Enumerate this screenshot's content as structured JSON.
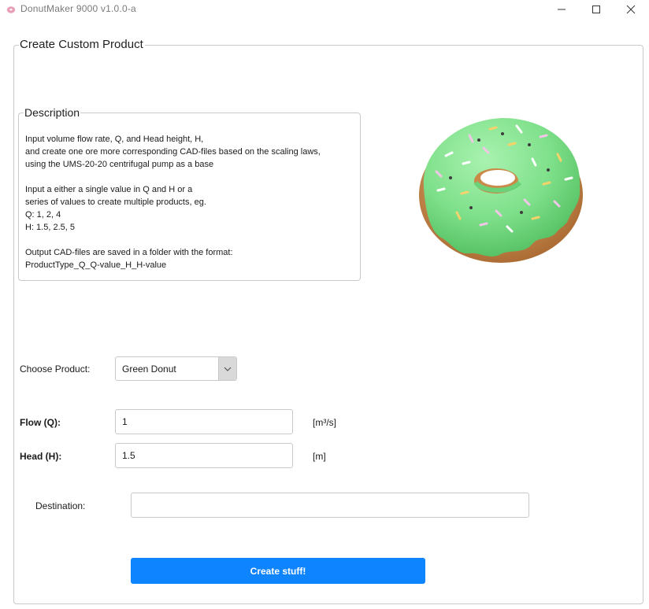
{
  "window": {
    "title": "DonutMaker 9000 v1.0.0-a",
    "icon": "donut-icon",
    "controls": [
      "minimize-icon",
      "maximize-icon",
      "close-icon"
    ]
  },
  "main": {
    "group_title": "Create Custom Product",
    "description": {
      "title": "Description",
      "lines": [
        "Input volume flow rate, Q, and Head height, H,",
        "and create one ore more corresponding CAD-files based on the scaling laws,",
        "using the UMS-20-20 centrifugal pump as a base",
        "",
        "Input a either a single value in Q and H or a",
        "series of values to create multiple products, eg.",
        "Q: 1, 2, 4",
        "H: 1.5, 2.5, 5",
        "",
        "Output CAD-files are saved in a folder with the format:",
        "ProductType_Q_Q-value_H_H-value"
      ]
    },
    "product": {
      "label": "Choose Product:",
      "selected": "Green Donut",
      "image": "green-donut-with-sprinkles"
    },
    "flow": {
      "label": "Flow (Q):",
      "value": "1",
      "unit": "[m³/s]"
    },
    "head": {
      "label": "Head (H):",
      "value": "1.5",
      "unit": "[m]"
    },
    "destination": {
      "label": "Destination:",
      "value": ""
    },
    "submit_label": "Create stuff!"
  },
  "colors": {
    "accent": "#0f84ff",
    "icing": "#7ee08a",
    "dough": "#c98a4a",
    "border": "#c9c9c9"
  }
}
